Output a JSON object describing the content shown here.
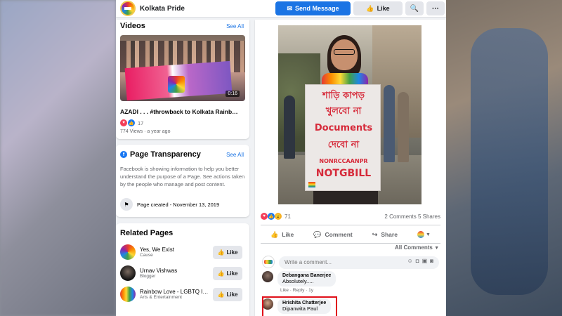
{
  "header": {
    "page_name": "Kolkata Pride",
    "send_message_label": "Send Message",
    "like_label": "Like",
    "search_icon": "search-icon",
    "more_icon": "more-icon"
  },
  "videos": {
    "title": "Videos",
    "see_all": "See All",
    "duration": "0:16",
    "video_title": "AZADI . . . #throwback to Kolkata Rainb…",
    "reaction_count": "17",
    "meta": "774 Views · a year ago"
  },
  "transparency": {
    "title": "Page Transparency",
    "see_all": "See All",
    "description": "Facebook is showing information to help you better understand the purpose of a Page. See actions taken by the people who manage and post content.",
    "page_created": "Page created - November 13, 2019"
  },
  "related": {
    "title": "Related Pages",
    "items": [
      {
        "name": "Yes, We Exist",
        "category": "Cause",
        "like": "Like"
      },
      {
        "name": "Urnav Vishwas",
        "category": "Blogger",
        "like": "Like"
      },
      {
        "name": "Rainbow Love - LGBTQ I…",
        "category": "Arts & Entertainment",
        "like": "Like"
      }
    ]
  },
  "post": {
    "placard_lines": [
      "শাড়ি কাপড়",
      "খুলবো না",
      "Documents",
      "দেবো না",
      "NONRCCAANPR",
      "NOTGBILL"
    ],
    "reaction_count": "71",
    "comments_shares": "2 Comments  5 Shares",
    "like_action": "Like",
    "comment_action": "Comment",
    "share_action": "Share",
    "all_comments": "All Comments",
    "comment_placeholder": "Write a comment...",
    "comments": [
      {
        "name": "Debangana Banerjee",
        "text": "Absolutely.....",
        "meta": "Like · Reply · 1y"
      },
      {
        "name": "Hrishita Chatterjee",
        "text": "Dipanwita Paul",
        "meta": ""
      }
    ]
  },
  "colors": {
    "brand_blue": "#1b74e4",
    "highlight_red": "#e0101a",
    "placard_text": "#d62a3a"
  }
}
